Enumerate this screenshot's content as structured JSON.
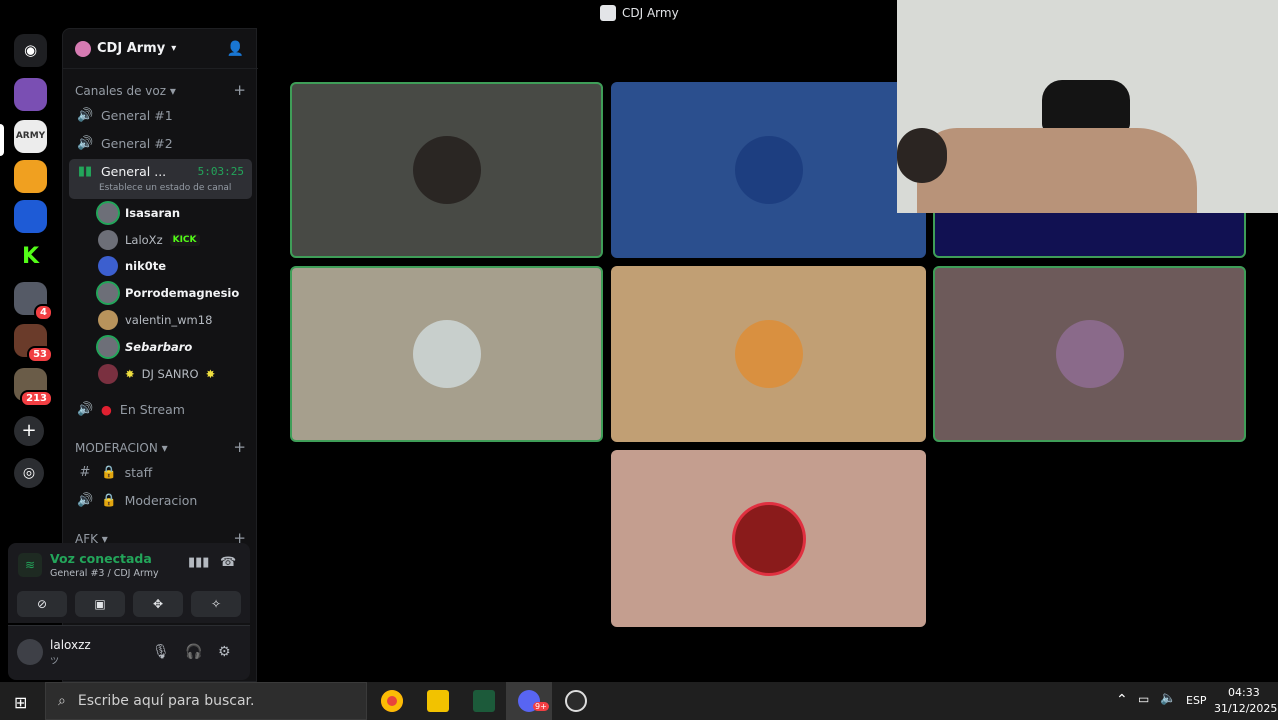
{
  "window": {
    "title": "CDJ Army"
  },
  "server_rail": {
    "items": [
      {
        "label": "",
        "color": "#5865f2"
      },
      {
        "label": "",
        "color": "#7a4fb3"
      },
      {
        "label": "ARMY",
        "color": "#ececec"
      },
      {
        "label": "",
        "color": "#f0a020"
      },
      {
        "label": "",
        "color": "#1e5bd6"
      },
      {
        "label": "K",
        "color": "#53fc18"
      },
      {
        "label": "",
        "color": "#555a66",
        "badge": "4"
      },
      {
        "label": "",
        "color": "#6a3b2a",
        "badge": "53"
      },
      {
        "label": "",
        "color": "#6a5c48",
        "badge": "213"
      }
    ]
  },
  "guild": {
    "name": "CDJ Army"
  },
  "sidebar": {
    "voice_category": "Canales de voz",
    "channels": [
      {
        "label": "General #1"
      },
      {
        "label": "General #2"
      },
      {
        "label": "General ...",
        "timer": "5:03:25",
        "status": "Establece un estado de canal"
      }
    ],
    "members": [
      {
        "name": "Isasaran",
        "speaking": true
      },
      {
        "name": "LaloXz",
        "tag": "KICK"
      },
      {
        "name": "nik0te"
      },
      {
        "name": "Porrodemagnesio",
        "speaking": true
      },
      {
        "name": "valentin_wm18"
      },
      {
        "name": "Sebarbaro",
        "speaking": true
      },
      {
        "name": "DJ SANRO"
      }
    ],
    "stream_channel": "En Stream",
    "moderation_category": "MODERACION",
    "mod_channels": [
      {
        "label": "staff"
      },
      {
        "label": "Moderacion"
      }
    ],
    "afk_category": "AFK"
  },
  "voice_panel": {
    "status": "Voz conectada",
    "channel": "General #3 / CDJ Army"
  },
  "user_panel": {
    "name": "laloxzz",
    "status": "ツ"
  },
  "tiles": [
    {
      "bg": "#484a45",
      "speaking": true
    },
    {
      "bg": "#2b4f8e",
      "speaking": false
    },
    {
      "bg": "#111152",
      "speaking": true
    },
    {
      "bg": "#a69f8d",
      "speaking": true
    },
    {
      "bg": "#c19f74",
      "speaking": false
    },
    {
      "bg": "#6d5a5a",
      "speaking": true
    },
    {
      "bg": "#c49e8f",
      "speaking": false
    }
  ],
  "taskbar": {
    "search_placeholder": "Escribe aquí para buscar.",
    "discord_badge": "9+",
    "lang": "ESP",
    "time": "04:33",
    "date": "31/12/2025"
  }
}
